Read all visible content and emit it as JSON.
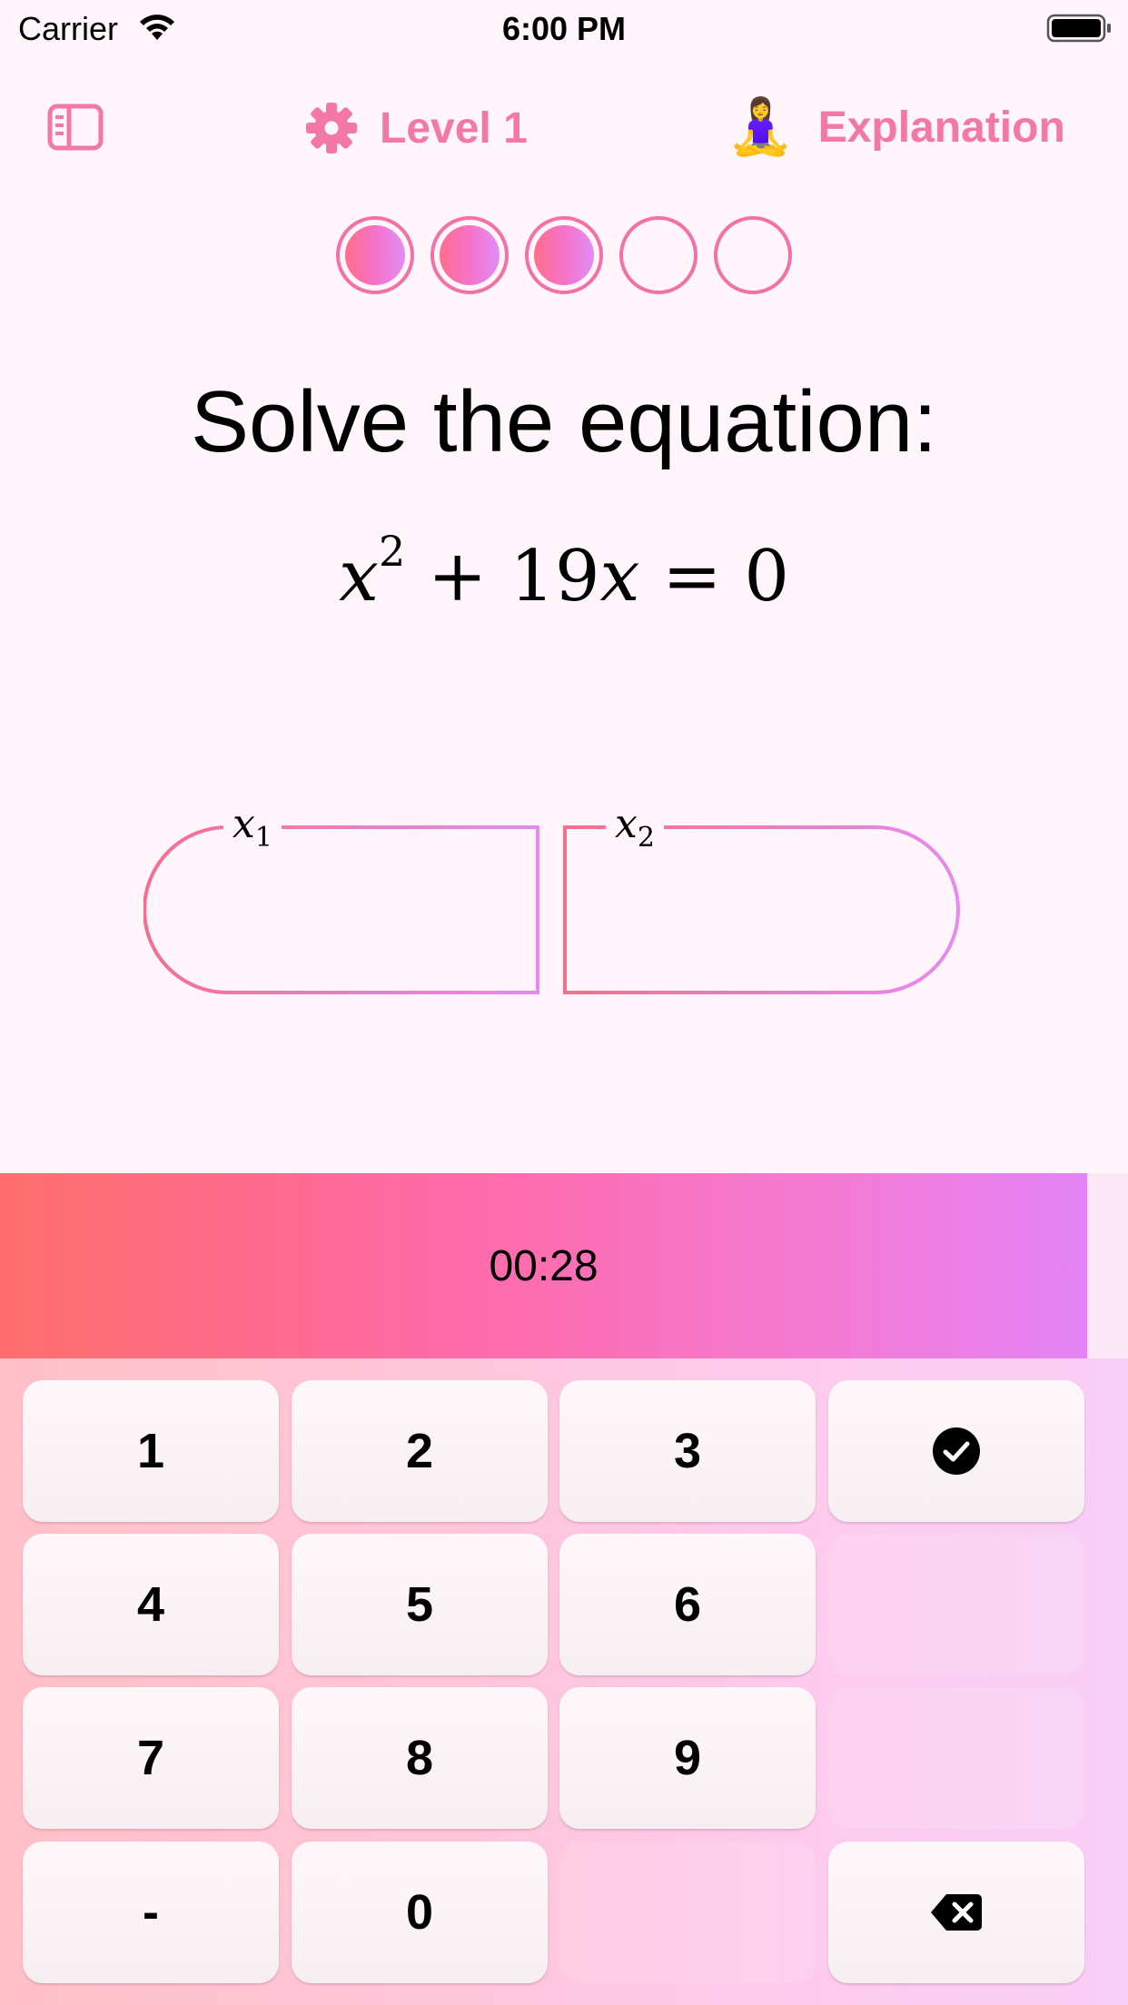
{
  "status_bar": {
    "carrier": "Carrier",
    "time": "6:00 PM"
  },
  "nav": {
    "sidebar_icon": "sidebar-icon",
    "level_icon": "gear-icon",
    "level_label": "Level 1",
    "explanation_emoji": "🧘‍♀️",
    "explanation_label": "Explanation",
    "accent_color": "#F378A6"
  },
  "progress": {
    "total": 5,
    "completed": 3
  },
  "prompt": "Solve the equation:",
  "equation": {
    "var": "x",
    "exp": "2",
    "op": "+",
    "coef": "19",
    "var2": "x",
    "eq": "=",
    "rhs": "0"
  },
  "answers": [
    {
      "label": "x",
      "sub": "1",
      "value": ""
    },
    {
      "label": "x",
      "sub": "2",
      "value": ""
    }
  ],
  "timer": "00:28",
  "keypad": {
    "k1": "1",
    "k2": "2",
    "k3": "3",
    "k4": "4",
    "k5": "5",
    "k6": "6",
    "k7": "7",
    "k8": "8",
    "k9": "9",
    "k0": "0",
    "minus": "-",
    "submit_icon": "checkmark-circle-icon",
    "delete_icon": "backspace-icon"
  }
}
